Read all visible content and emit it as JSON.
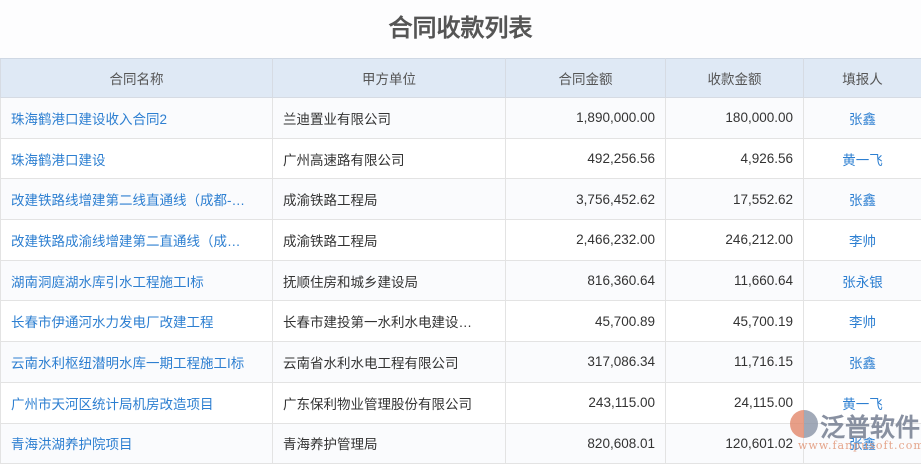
{
  "title": "合同收款列表",
  "columns": [
    "合同名称",
    "甲方单位",
    "合同金额",
    "收款金额",
    "填报人"
  ],
  "rows": [
    [
      "珠海鹤港口建设收入合同2",
      "兰迪置业有限公司",
      "1,890,000.00",
      "180,000.00",
      "张鑫"
    ],
    [
      "珠海鹤港口建设",
      "广州高速路有限公司",
      "492,256.56",
      "4,926.56",
      "黄一飞"
    ],
    [
      "改建铁路线增建第二线直通线（成都-…",
      "成渝铁路工程局",
      "3,756,452.62",
      "17,552.62",
      "张鑫"
    ],
    [
      "改建铁路成渝线增建第二直通线（成…",
      "成渝铁路工程局",
      "2,466,232.00",
      "246,212.00",
      "李帅"
    ],
    [
      "湖南洞庭湖水库引水工程施工I标",
      "抚顺住房和城乡建设局",
      "816,360.64",
      "11,660.64",
      "张永银"
    ],
    [
      "长春市伊通河水力发电厂改建工程",
      "长春市建投第一水利水电建设…",
      "45,700.89",
      "45,700.19",
      "李帅"
    ],
    [
      "云南水利枢纽潜明水库一期工程施工I标",
      "云南省水利水电工程有限公司",
      "317,086.34",
      "11,716.15",
      "张鑫"
    ],
    [
      "广州市天河区统计局机房改造项目",
      "广东保利物业管理股份有限公司",
      "243,115.00",
      "24,115.00",
      "黄一飞"
    ],
    [
      "青海洪湖养护院项目",
      "青海养护管理局",
      "820,608.01",
      "120,601.02",
      "张鑫"
    ]
  ],
  "watermark": {
    "brand": "泛普软件",
    "url": "www.fanpusoft.com"
  }
}
